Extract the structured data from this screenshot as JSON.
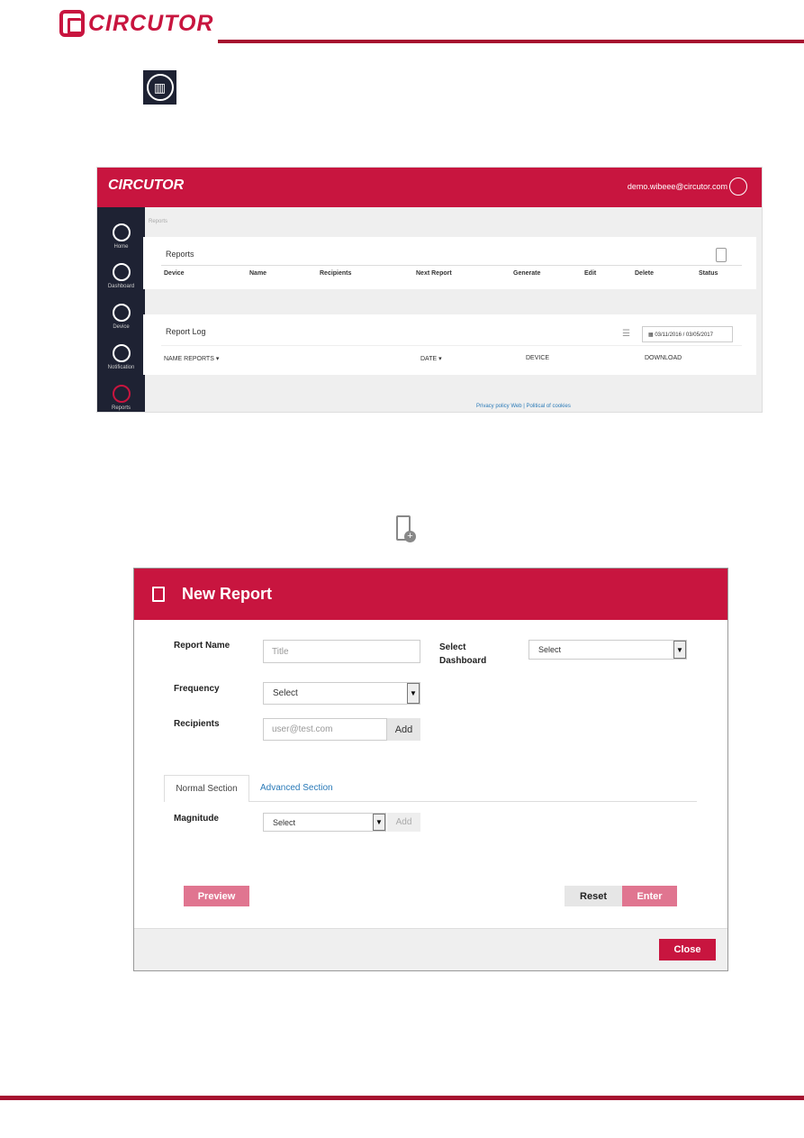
{
  "page": {
    "brand": "CIRCUTOR"
  },
  "app": {
    "brand": "CIRCUTOR",
    "user_email": "demo.wibeee@circutor.com",
    "breadcrumb": "Reports",
    "sidebar": [
      {
        "label": "Home"
      },
      {
        "label": "Dashboard"
      },
      {
        "label": "Device"
      },
      {
        "label": "Notification"
      },
      {
        "label": "Reports"
      }
    ],
    "reports": {
      "title": "Reports",
      "columns": [
        "Device",
        "Name",
        "Recipients",
        "Next Report",
        "Generate",
        "Edit",
        "Delete",
        "Status"
      ]
    },
    "report_log": {
      "title": "Report Log",
      "date_range": "03/11/2016 / 03/05/2017",
      "columns": [
        "NAME REPORTS",
        "DATE",
        "DEVICE",
        "DOWNLOAD"
      ]
    },
    "footer": {
      "privacy": "Privacy policy Web",
      "separator": "|",
      "cookies": "Political of cookies"
    }
  },
  "modal": {
    "title": "New Report",
    "report_name_label": "Report Name",
    "report_name_placeholder": "Title",
    "dashboard_label": "Select Dashboard",
    "dashboard_value": "Select",
    "frequency_label": "Frequency",
    "frequency_value": "Select",
    "recipients_label": "Recipients",
    "recipients_placeholder": "user@test.com",
    "add_label": "Add",
    "tabs": [
      "Normal Section",
      "Advanced Section"
    ],
    "magnitude_label": "Magnitude",
    "magnitude_value": "Select",
    "magnitude_add": "Add",
    "preview": "Preview",
    "reset": "Reset",
    "enter": "Enter",
    "close": "Close"
  },
  "colors": {
    "brand": "#c8153f",
    "sidebar": "#1e2233",
    "link": "#2a7ab8"
  }
}
